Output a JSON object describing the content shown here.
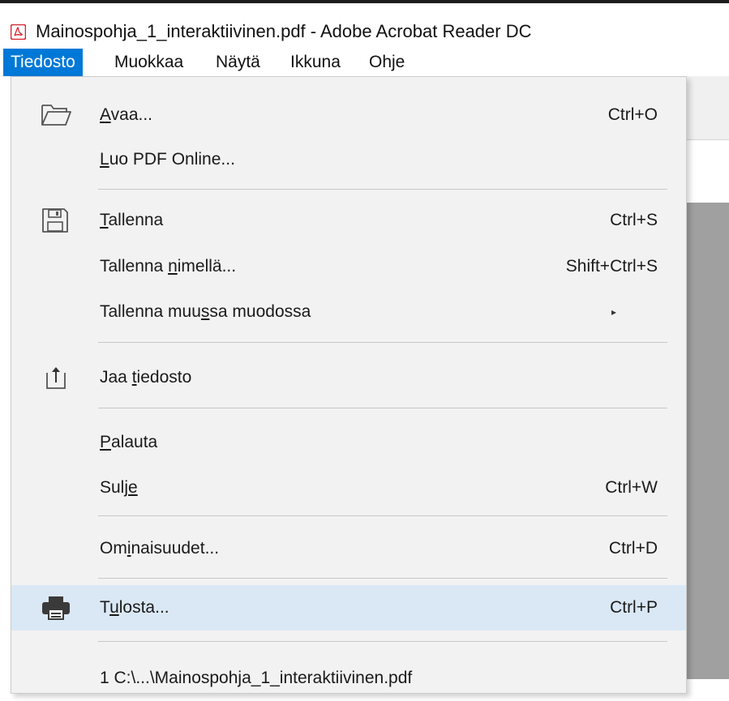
{
  "window": {
    "title": "Mainospohja_1_interaktiivinen.pdf - Adobe Acrobat Reader DC"
  },
  "menubar": {
    "items": [
      "Tiedosto",
      "Muokkaa",
      "Näytä",
      "Ikkuna",
      "Ohje"
    ],
    "active": "Tiedosto"
  },
  "file_menu": {
    "open": {
      "pre": "",
      "u": "A",
      "post": "vaa...",
      "shortcut": "Ctrl+O",
      "icon": "folder-open-icon"
    },
    "create_pdf": {
      "pre": "",
      "u": "L",
      "post": "uo PDF Online..."
    },
    "save": {
      "pre": "",
      "u": "T",
      "post": "allenna",
      "shortcut": "Ctrl+S",
      "icon": "save-icon"
    },
    "save_as": {
      "pre": "Tallenna ",
      "u": "n",
      "post": "imellä...",
      "shortcut": "Shift+Ctrl+S"
    },
    "save_other": {
      "pre": "Tallenna muu",
      "u": "s",
      "post": "sa muodossa",
      "submenu_arrow": "▸"
    },
    "share": {
      "pre": "Jaa ",
      "u": "t",
      "post": "iedosto",
      "icon": "share-icon"
    },
    "revert": {
      "pre": "",
      "u": "P",
      "post": "alauta"
    },
    "close": {
      "pre": "Sulj",
      "u": "e",
      "post": "",
      "shortcut": "Ctrl+W"
    },
    "properties": {
      "pre": "Om",
      "u": "i",
      "post": "naisuudet...",
      "shortcut": "Ctrl+D"
    },
    "print": {
      "pre": "T",
      "u": "u",
      "post": "losta...",
      "shortcut": "Ctrl+P",
      "icon": "printer-icon",
      "highlighted": true
    },
    "recent_1": {
      "label": "1 C:\\...\\Mainospohja_1_interaktiivinen.pdf"
    }
  },
  "colors": {
    "menu_active_bg": "#0078d7",
    "dropdown_bg": "#f2f2f2",
    "highlight_bg": "#dae8f5",
    "acrobat_red": "#d2232a"
  }
}
